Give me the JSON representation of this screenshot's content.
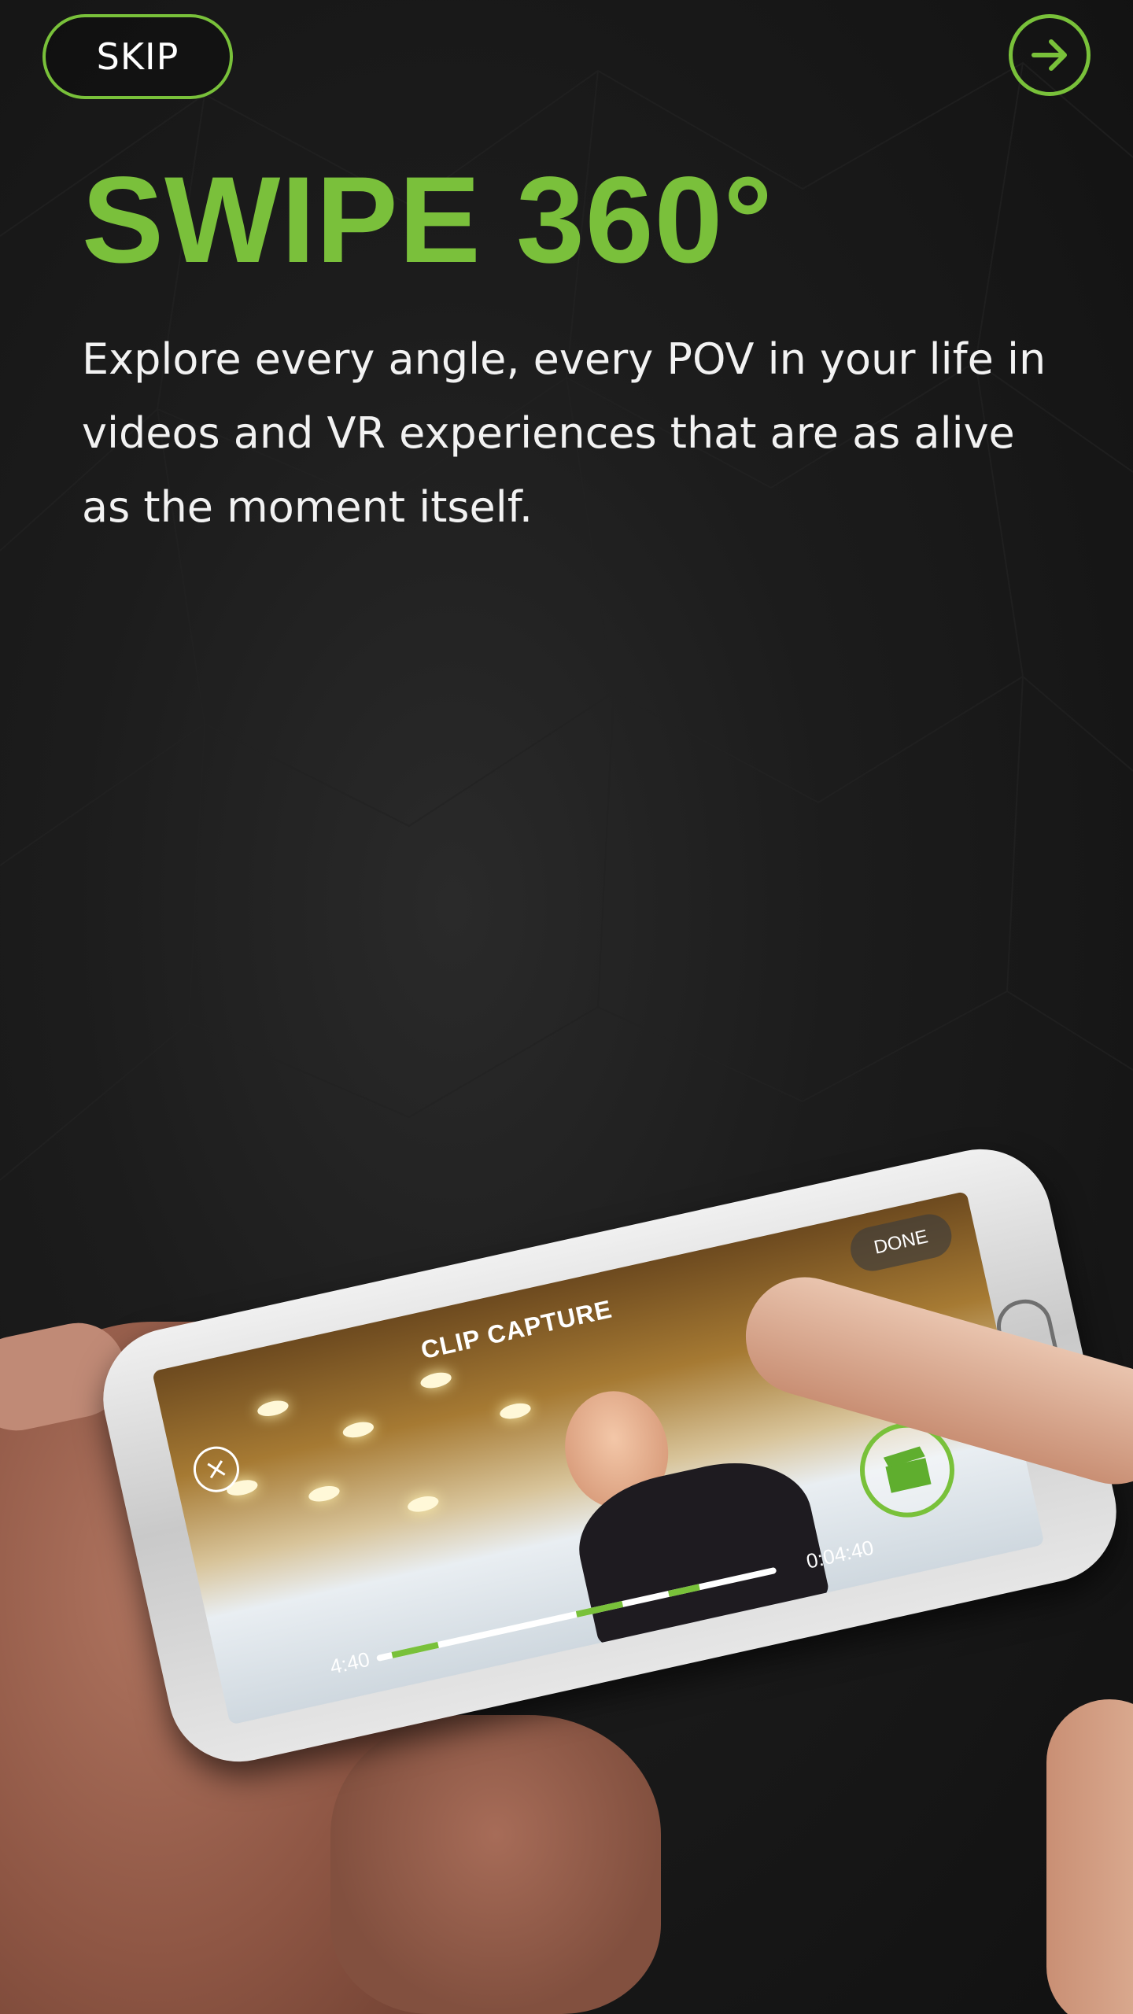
{
  "colors": {
    "accent": "#79c13a",
    "background": "#141414",
    "text": "#f2f2f2"
  },
  "header": {
    "skip_label": "SKIP",
    "next_icon": "arrow-right-icon"
  },
  "content": {
    "title": "SWIPE 360°",
    "description": "Explore every angle, every POV in your life in videos and VR experiences that are as alive as the moment itself."
  },
  "phone_screen": {
    "clip_label": "CLIP CAPTURE",
    "done_label": "DONE",
    "time_start": "4:40",
    "time_end": "0:04:40",
    "close_icon": "close-icon",
    "record_icon": "clapperboard-icon"
  }
}
